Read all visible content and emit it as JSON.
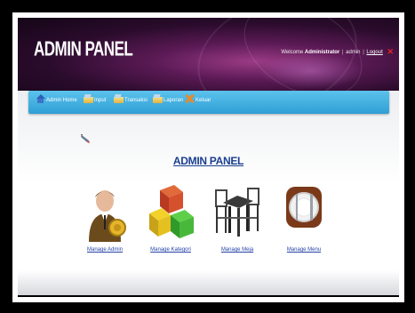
{
  "header": {
    "brand": "ADMIN PANEL",
    "welcome_prefix": "Welcome",
    "user_name": "Administrator",
    "username": "admin",
    "logout_label": "Logout"
  },
  "nav": {
    "items": [
      {
        "label": "Admin Home",
        "icon": "house-icon"
      },
      {
        "label": "Input",
        "icon": "folder-icon"
      },
      {
        "label": "Transaksi",
        "icon": "folder-icon"
      },
      {
        "label": "Laporan",
        "icon": "folder-icon"
      },
      {
        "label": "Keluar",
        "icon": "close-icon"
      }
    ]
  },
  "main": {
    "title": "ADMIN PANEL",
    "tiles": [
      {
        "label": "Manage Admin",
        "icon": "admin-person-icon"
      },
      {
        "label": "Manage Kategori",
        "icon": "category-boxes-icon"
      },
      {
        "label": "Manage Meja",
        "icon": "table-chairs-icon"
      },
      {
        "label": "Manage Menu",
        "icon": "plate-cutlery-icon"
      }
    ]
  },
  "colors": {
    "navbar": "#2f9fd6",
    "title": "#1a3f8e",
    "link": "#2443a6",
    "logout_x": "#e22222"
  }
}
